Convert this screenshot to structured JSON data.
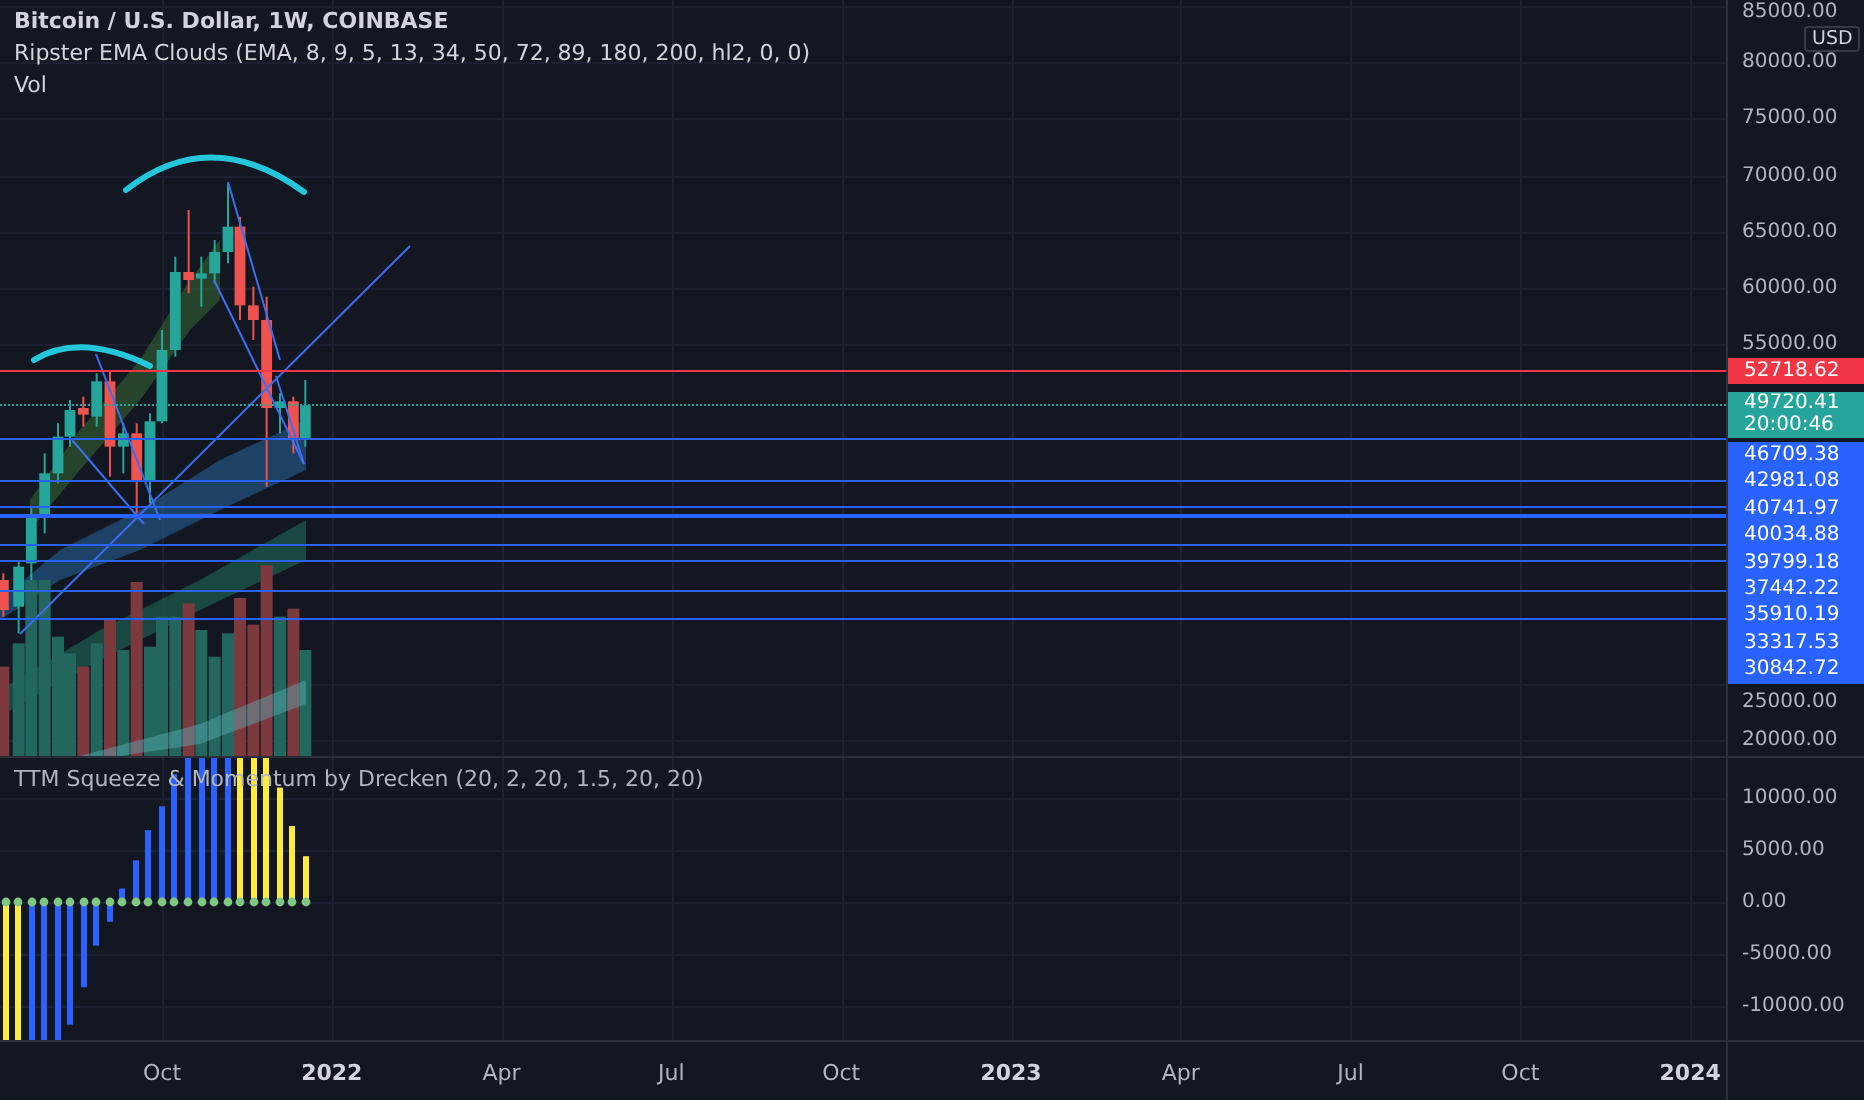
{
  "chart": {
    "title": "Bitcoin / U.S. Dollar, 1W, COINBASE",
    "studies": [
      "Ripster EMA Clouds (EMA, 8, 9, 5, 13, 34, 50, 72, 89, 180, 200, hl2, 0, 0)",
      "Vol"
    ],
    "currency": "USD",
    "price_ticks": [
      "85000.00",
      "80000.00",
      "75000.00",
      "70000.00",
      "65000.00",
      "60000.00",
      "55000.00",
      "25000.00",
      "20000.00"
    ],
    "price_lines": [
      {
        "kind": "alert",
        "price": "52718.62"
      },
      {
        "kind": "last",
        "price": "49720.41",
        "countdown": "20:00:46"
      },
      {
        "kind": "level",
        "price": "46709.38"
      },
      {
        "kind": "level",
        "price": "42981.08"
      },
      {
        "kind": "level",
        "price": "40741.97"
      },
      {
        "kind": "level",
        "price": "40034.88"
      },
      {
        "kind": "level",
        "price": "39799.18"
      },
      {
        "kind": "level",
        "price": "37442.22"
      },
      {
        "kind": "level",
        "price": "35910.19"
      },
      {
        "kind": "level",
        "price": "33317.53"
      },
      {
        "kind": "level",
        "price": "30842.72"
      }
    ]
  },
  "indicator": {
    "title": "TTM Squeeze & Momentum by Drecken (20, 2, 20, 1.5, 20, 20)",
    "ticks": [
      "10000.00",
      "5000.00",
      "0.00",
      "-5000.00",
      "-10000.00"
    ]
  },
  "time_axis": [
    {
      "label": "Oct",
      "bold": false
    },
    {
      "label": "2022",
      "bold": true
    },
    {
      "label": "Apr",
      "bold": false
    },
    {
      "label": "Jul",
      "bold": false
    },
    {
      "label": "Oct",
      "bold": false
    },
    {
      "label": "2023",
      "bold": true
    },
    {
      "label": "Apr",
      "bold": false
    },
    {
      "label": "Jul",
      "bold": false
    },
    {
      "label": "Oct",
      "bold": false
    },
    {
      "label": "2024",
      "bold": true
    }
  ]
}
